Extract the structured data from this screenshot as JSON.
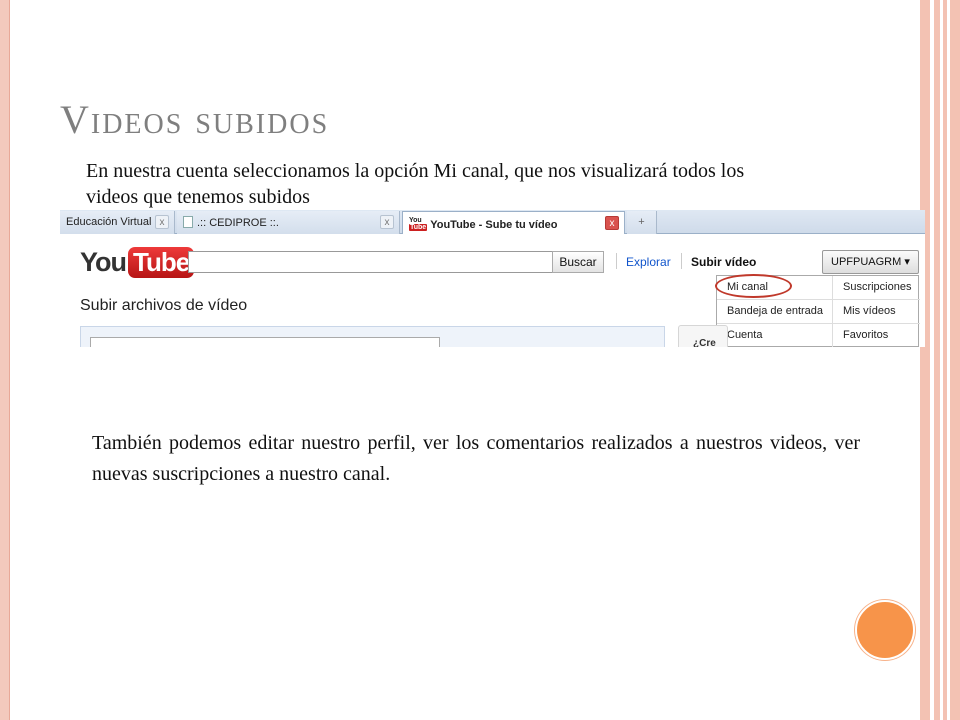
{
  "slide": {
    "title": "Videos subidos",
    "intro": "En nuestra cuenta seleccionamos la opción Mi canal, que nos visualizará todos los videos que tenemos subidos",
    "body": "También podemos editar nuestro perfil, ver los comentarios realizados a nuestros videos, ver nuevas suscripciones a nuestro canal."
  },
  "browser": {
    "tabs": [
      {
        "label": "Educación Virtual",
        "close": "x"
      },
      {
        "label": ".:: CEDIPROE ::.",
        "close": "x"
      },
      {
        "label": "YouTube - Sube tu vídeo",
        "close": "x"
      }
    ],
    "new_tab": "+"
  },
  "youtube": {
    "logo_you": "You",
    "logo_tube": "Tube",
    "search_button": "Buscar",
    "nav": {
      "explore": "Explorar",
      "upload": "Subir vídeo"
    },
    "user_menu": "UPFPUAGRM ▾",
    "dropdown": {
      "left": [
        "Mi canal",
        "Bandeja de entrada",
        "Cuenta"
      ],
      "right": [
        "Suscripciones",
        "Mis vídeos",
        "Favoritos"
      ]
    },
    "upload_heading": "Subir archivos de vídeo",
    "side_box_label": "¿Cre"
  },
  "colors": {
    "accent": "#f7944a",
    "frame": "#f3c2b3",
    "youtube_red": "#cc2020",
    "link_blue": "#1155cc",
    "highlight": "#c0392b"
  }
}
